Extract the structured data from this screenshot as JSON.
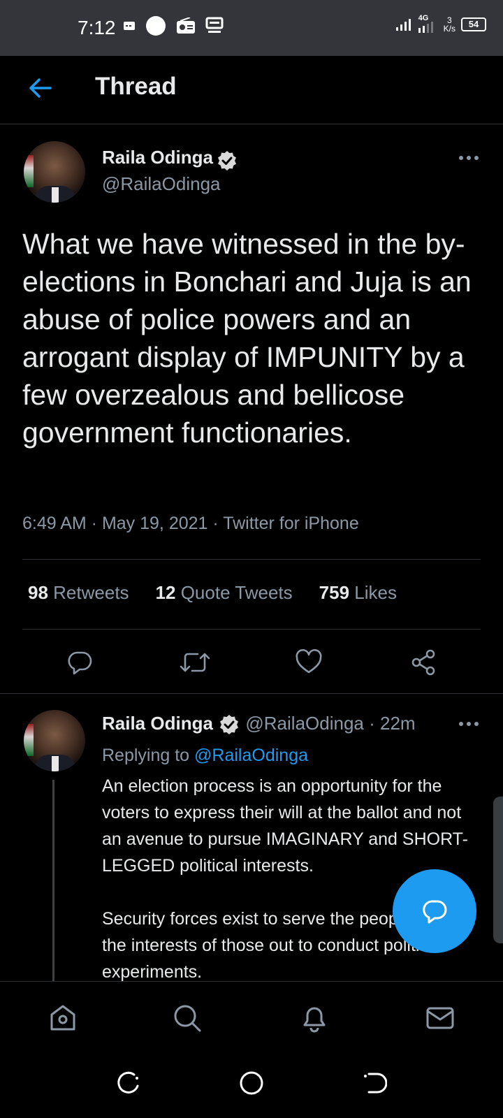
{
  "status_bar": {
    "time": "7:12",
    "network": "4G",
    "speed_value": "3",
    "speed_unit": "K/s",
    "battery": "54"
  },
  "header": {
    "title": "Thread"
  },
  "tweet": {
    "author_name": "Raila Odinga",
    "author_handle": "@RailaOdinga",
    "text": "What we have witnessed in the by-elections in Bonchari and Juja is an abuse of police powers and an arrogant display of IMPUNITY by a few overzealous and bellicose government functionaries.",
    "meta": "6:49 AM · May 19, 2021 · Twitter for iPhone",
    "retweets_count": "98",
    "retweets_label": "Retweets",
    "quotes_count": "12",
    "quotes_label": "Quote Tweets",
    "likes_count": "759",
    "likes_label": "Likes"
  },
  "reply": {
    "author_name": "Raila Odinga",
    "author_handle": "@RailaOdinga",
    "age": "· 22m",
    "replying_prefix": "Replying to",
    "replying_handle": "@RailaOdinga",
    "paragraph1": "An election process is an opportunity for the voters to express their will at the ballot and not an avenue to pursue IMAGINARY and SHORT-LEGGED political interests.",
    "paragraph2": "Security forces exist to serve the people and not the interests of those out to conduct political experiments."
  },
  "colors": {
    "accent": "#1d9bf0",
    "background": "#000000",
    "muted": "#8b98a5",
    "status_bar": "#34353a"
  },
  "icons": {
    "back": "arrow-left-icon",
    "more": "more-horizontal-icon",
    "verified": "verified-badge-icon",
    "reply": "reply-icon",
    "retweet": "retweet-icon",
    "like": "heart-icon",
    "share": "share-icon",
    "compose": "compose-reply-icon",
    "home": "home-icon",
    "search": "search-icon",
    "notifications": "bell-icon",
    "messages": "mail-icon"
  }
}
